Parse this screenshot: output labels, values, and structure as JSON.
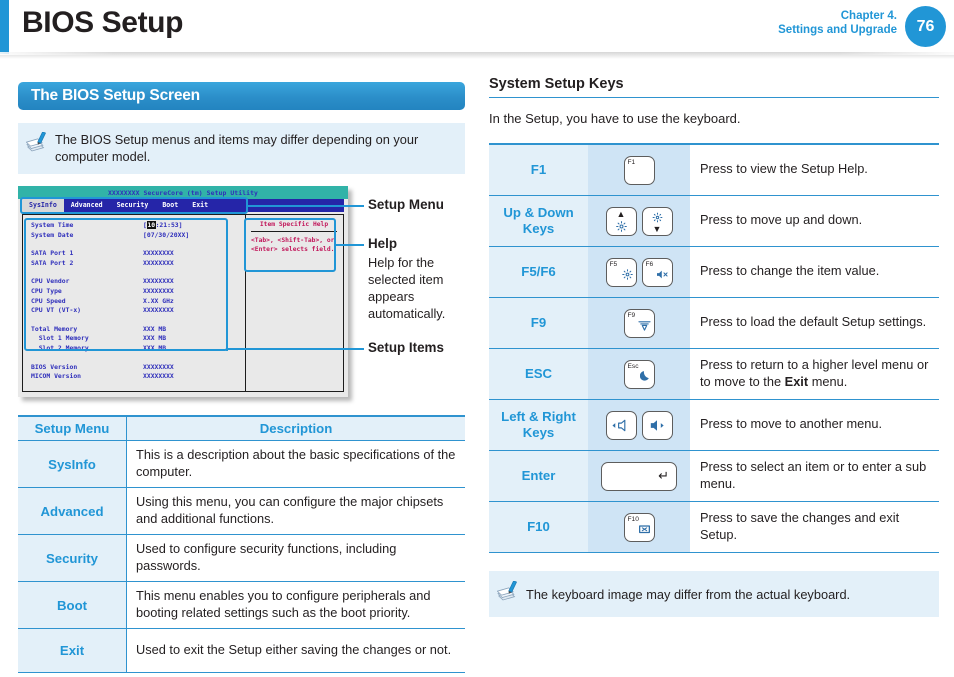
{
  "header": {
    "title": "BIOS Setup",
    "chapter_line1": "Chapter 4.",
    "chapter_line2": "Settings and Upgrade",
    "page_number": "76"
  },
  "left": {
    "section_title": "The BIOS Setup Screen",
    "note": "The BIOS Setup menus and items may differ depending on your computer model.",
    "bios_screen": {
      "title": "XXXXXXXX SecureCore (tm) Setup Utility",
      "menus": [
        "SysInfo",
        "Advanced",
        "Security",
        "Boot",
        "Exit"
      ],
      "active_menu": "SysInfo",
      "items": [
        {
          "label": "System Time",
          "value_prefix": "[",
          "value_highlight": "10",
          "value_suffix": ":21:53]"
        },
        {
          "label": "System Date",
          "value": "[07/30/20XX]"
        },
        {
          "gap": true
        },
        {
          "label": "SATA Port 1",
          "value": "XXXXXXXX"
        },
        {
          "label": "SATA Port 2",
          "value": "XXXXXXXX"
        },
        {
          "gap": true
        },
        {
          "label": "CPU Vendor",
          "value": "XXXXXXXX"
        },
        {
          "label": "CPU Type",
          "value": "XXXXXXXX"
        },
        {
          "label": "CPU Speed",
          "value": "X.XX GHz"
        },
        {
          "label": "CPU VT (VT-x)",
          "value": "XXXXXXXX"
        },
        {
          "gap": true
        },
        {
          "label": "Total Memory",
          "value": "XXX MB"
        },
        {
          "label": "  Slot 1 Memory",
          "value": "XXX MB"
        },
        {
          "label": "  Slot 2 Memory",
          "value": "XXX MB"
        },
        {
          "gap": true
        },
        {
          "label": "BIOS Version",
          "value": "XXXXXXXX"
        },
        {
          "label": "MICOM Version",
          "value": "XXXXXXXX"
        }
      ],
      "help_title": "Item Specific Help",
      "help_body": "<Tab>, <Shift-Tab>, or <Enter> selects field."
    },
    "annotations": {
      "setup_menu": "Setup Menu",
      "help": "Help",
      "help_desc": "Help for the selected item appears automatically.",
      "setup_items": "Setup Items"
    },
    "table": {
      "headers": [
        "Setup Menu",
        "Description"
      ],
      "rows": [
        {
          "menu": "SysInfo",
          "description": "This is a description about the basic specifications of the computer."
        },
        {
          "menu": "Advanced",
          "description": "Using this menu, you can configure the major chipsets and additional functions."
        },
        {
          "menu": "Security",
          "description": "Used to configure security functions, including passwords."
        },
        {
          "menu": "Boot",
          "description": "This menu enables you to configure peripherals and booting related settings such as the boot priority."
        },
        {
          "menu": "Exit",
          "description": "Used to exit the Setup either saving the changes or not."
        }
      ]
    }
  },
  "right": {
    "heading": "System Setup Keys",
    "intro": "In the Setup, you have to use the keyboard.",
    "rows": [
      {
        "key": "F1",
        "keycaps": [
          {
            "top_left": "F1"
          }
        ],
        "description": "Press to view the Setup Help."
      },
      {
        "key": "Up & Down Keys",
        "keycaps": [
          {
            "up_arrow": "▲",
            "bottom_glyph": "brightness-up-icon"
          },
          {
            "top_glyph": "brightness-down-icon",
            "down_arrow": "▼"
          }
        ],
        "description": "Press to move up and down."
      },
      {
        "key": "F5/F6",
        "keycaps": [
          {
            "top_left": "F5",
            "bottom_glyph": "brightness-icon"
          },
          {
            "top_left": "F6",
            "bottom_glyph": "mute-icon"
          }
        ],
        "description": "Press to change the item value."
      },
      {
        "key": "F9",
        "keycaps": [
          {
            "top_left": "F9",
            "bottom_glyph": "wireless-icon"
          }
        ],
        "description": "Press to load the default Setup settings."
      },
      {
        "key": "ESC",
        "keycaps": [
          {
            "top_left": "Esc",
            "bottom_glyph": "sleep-moon-icon"
          }
        ],
        "description_pre": "Press to return to a higher level menu or to move to the ",
        "description_bold": "Exit",
        "description_post": " menu."
      },
      {
        "key": "Left & Right Keys",
        "keycaps": [
          {
            "center_glyph": "volume-down-icon"
          },
          {
            "center_glyph": "volume-up-icon"
          }
        ],
        "description": "Press to move to another menu."
      },
      {
        "key": "Enter",
        "keycaps": [
          {
            "wide": true,
            "enter_glyph": "↵"
          }
        ],
        "description": "Press to select an item or to enter a sub menu."
      },
      {
        "key": "F10",
        "keycaps": [
          {
            "top_left": "F10",
            "bottom_glyph": "display-off-icon"
          }
        ],
        "description": "Press to save the changes and exit Setup."
      }
    ],
    "note": "The keyboard image may differ from the actual keyboard."
  },
  "colors": {
    "accent_blue": "#2196d6",
    "note_bg": "#e3f0f9",
    "key_icon_bg": "#cfe4f5",
    "bios_title_bg": "#31b3a8",
    "bios_menu_bg": "#2525a8",
    "bios_text": "#2f2fbb",
    "bios_help_text": "#c2185b"
  }
}
